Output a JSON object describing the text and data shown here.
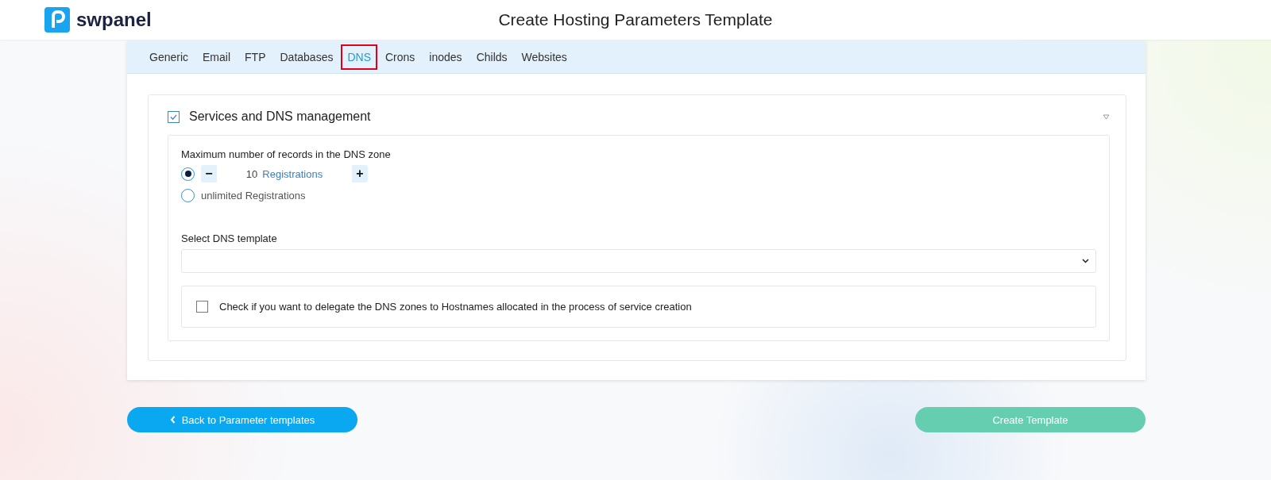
{
  "header": {
    "logo_text": "swpanel",
    "title": "Create Hosting Parameters Template"
  },
  "tabs": [
    {
      "label": "Generic",
      "selected": false
    },
    {
      "label": "Email",
      "selected": false
    },
    {
      "label": "FTP",
      "selected": false
    },
    {
      "label": "Databases",
      "selected": false
    },
    {
      "label": "DNS",
      "selected": true
    },
    {
      "label": "Crons",
      "selected": false
    },
    {
      "label": "inodes",
      "selected": false
    },
    {
      "label": "Childs",
      "selected": false
    },
    {
      "label": "Websites",
      "selected": false
    }
  ],
  "section": {
    "title": "Services and DNS management",
    "checked": true,
    "expanded": true,
    "records": {
      "label": "Maximum number of records in the DNS zone",
      "options": [
        {
          "kind": "stepper",
          "selected": true,
          "value": "10",
          "unit": "Registrations",
          "minus": "−",
          "plus": "+"
        },
        {
          "kind": "text",
          "selected": false,
          "label": "unlimited Registrations"
        }
      ]
    },
    "dns_template": {
      "label": "Select DNS template"
    },
    "delegate": {
      "label": "Check if you want to delegate the DNS zones to Hostnames allocated in the process of service creation",
      "checked": false
    }
  },
  "buttons": {
    "back": "Back to Parameter templates",
    "create": "Create Template"
  }
}
